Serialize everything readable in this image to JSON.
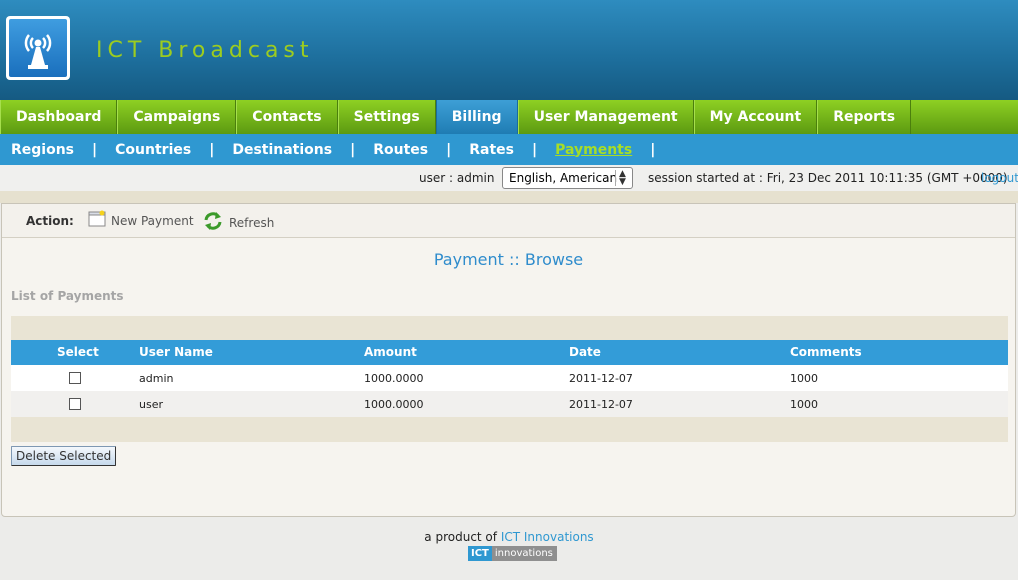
{
  "header": {
    "title": "ICT Broadcast",
    "logo_icon": "broadcast-tower-icon"
  },
  "mainnav": {
    "items": [
      {
        "label": "Dashboard",
        "active": false
      },
      {
        "label": "Campaigns",
        "active": false
      },
      {
        "label": "Contacts",
        "active": false
      },
      {
        "label": "Settings",
        "active": false
      },
      {
        "label": "Billing",
        "active": true
      },
      {
        "label": "User Management",
        "active": false
      },
      {
        "label": "My Account",
        "active": false
      },
      {
        "label": "Reports",
        "active": false
      }
    ]
  },
  "subnav": {
    "separator": "|",
    "items": [
      {
        "label": "Regions",
        "active": false
      },
      {
        "label": "Countries",
        "active": false
      },
      {
        "label": "Destinations",
        "active": false
      },
      {
        "label": "Routes",
        "active": false
      },
      {
        "label": "Rates",
        "active": false
      },
      {
        "label": "Payments",
        "active": true
      }
    ]
  },
  "session": {
    "user_label": "user : admin",
    "language": "English, American",
    "session_text": "session started at : Fri, 23 Dec 2011 10:11:35 (GMT +0000)",
    "logout": "logout"
  },
  "actions": {
    "label": "Action:",
    "new_payment": "New Payment",
    "refresh": "Refresh"
  },
  "page": {
    "heading": "Payment :: Browse",
    "list_title": "List of Payments"
  },
  "table": {
    "headers": {
      "select": "Select",
      "user": "User Name",
      "amount": "Amount",
      "date": "Date",
      "comments": "Comments"
    },
    "rows": [
      {
        "user": "admin",
        "amount": "1000.0000",
        "date": "2011-12-07",
        "comments": "1000",
        "checked": false
      },
      {
        "user": "user",
        "amount": "1000.0000",
        "date": "2011-12-07",
        "comments": "1000",
        "checked": false
      }
    ]
  },
  "buttons": {
    "delete_selected": "Delete Selected"
  },
  "footer": {
    "prefix": "a product of",
    "company": "ICT Innovations",
    "badge_ict": "ICT",
    "badge_innovations": "innovations"
  },
  "colors": {
    "header_blue": "#1d6e9c",
    "title_green": "#9dcc1f",
    "nav_green": "#7cbf1c",
    "accent_blue": "#2f98d1"
  }
}
